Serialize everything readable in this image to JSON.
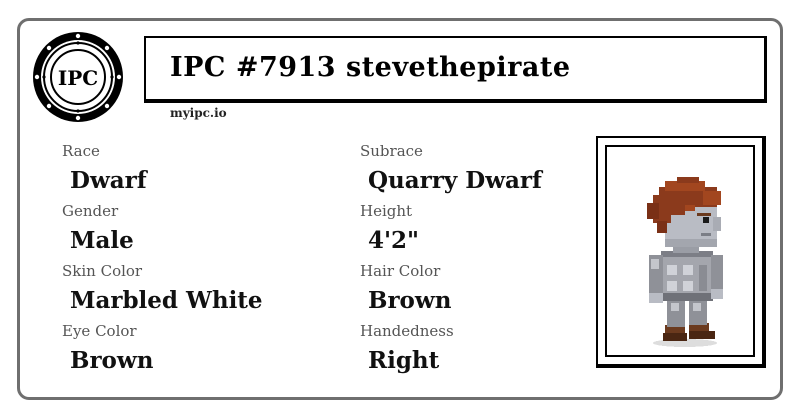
{
  "logo": {
    "text": "IPC",
    "icon": "ipc-seal-logo"
  },
  "title": "IPC #7913 stevethepirate",
  "site": "myipc.io",
  "fields": {
    "race": {
      "label": "Race",
      "value": "Dwarf"
    },
    "subrace": {
      "label": "Subrace",
      "value": "Quarry Dwarf"
    },
    "gender": {
      "label": "Gender",
      "value": "Male"
    },
    "height": {
      "label": "Height",
      "value": "4'2\""
    },
    "skin_color": {
      "label": "Skin Color",
      "value": "Marbled White"
    },
    "hair_color": {
      "label": "Hair Color",
      "value": "Brown"
    },
    "eye_color": {
      "label": "Eye Color",
      "value": "Brown"
    },
    "handedness": {
      "label": "Handedness",
      "value": "Right"
    }
  },
  "portrait": {
    "icon": "dwarf-character-sprite"
  },
  "colors": {
    "card_border": "#6f6f6f",
    "hair": "#8b3a1c",
    "skin": "#b9bcc4",
    "armor": "#a4a6ad",
    "boots": "#6b3a1e"
  }
}
